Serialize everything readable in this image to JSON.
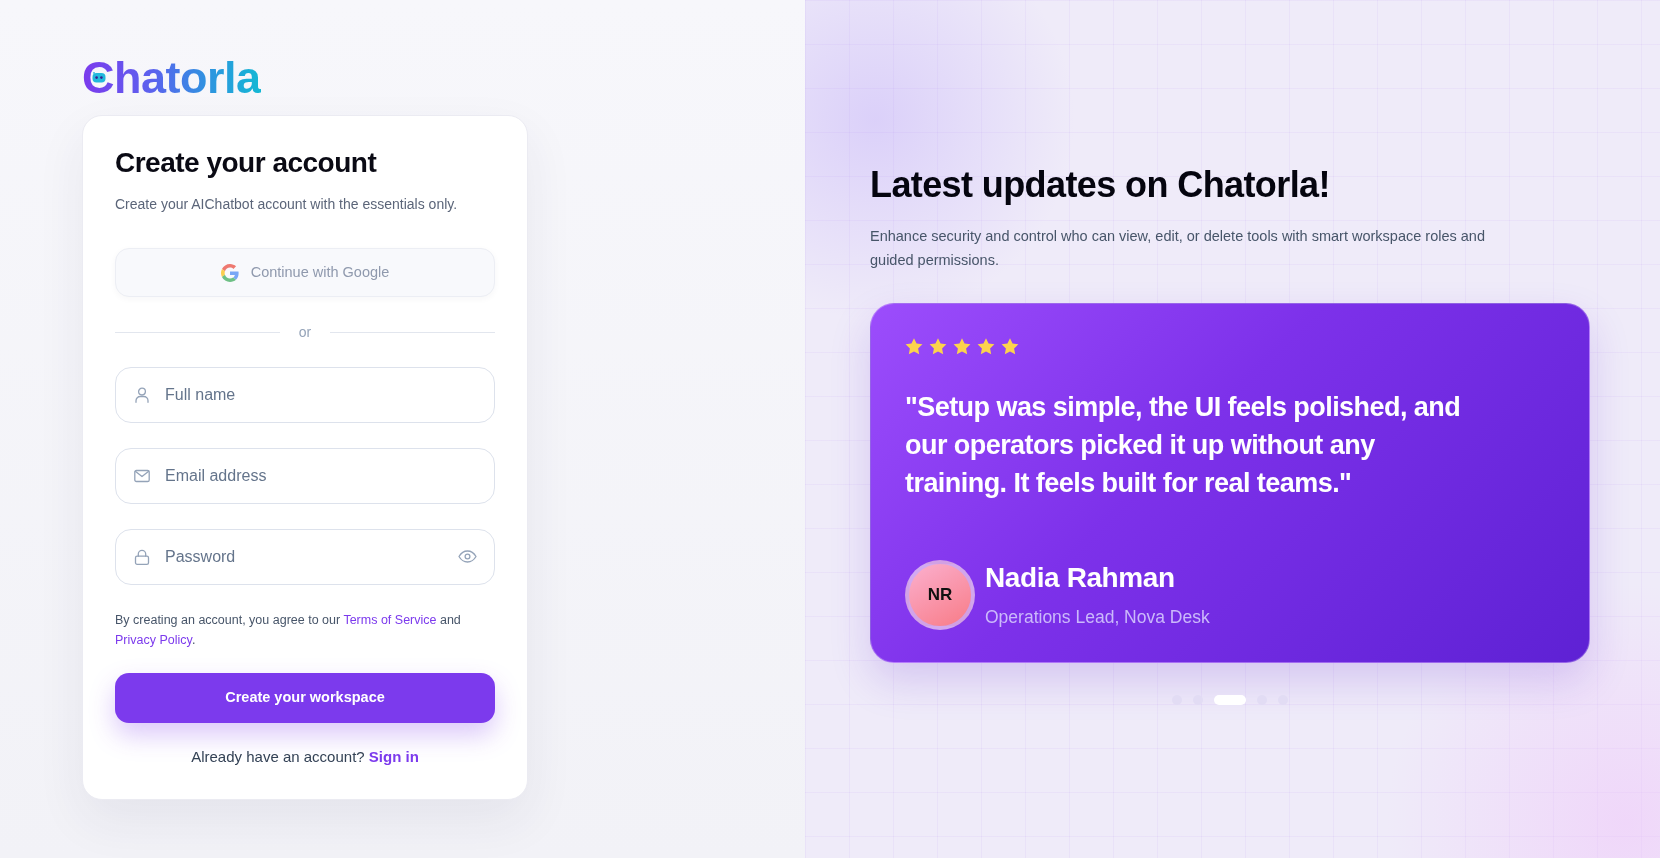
{
  "logo": {
    "text": "Chatorla"
  },
  "signup_card": {
    "title": "Create your account",
    "subtitle": "Create your AIChatbot account with the essentials only.",
    "google_button": {
      "label": "Continue with Google",
      "disabled": true
    },
    "divider": "or",
    "fields": [
      {
        "kind": "text",
        "placeholder": "Full name"
      },
      {
        "kind": "email",
        "placeholder": "Email address"
      },
      {
        "kind": "password",
        "placeholder": "Password"
      }
    ],
    "terms": [
      {
        "kind": "text",
        "text": "By creating an account, you agree to our "
      },
      {
        "kind": "link",
        "text": "Terms of Service"
      },
      {
        "kind": "text",
        "text": " and "
      },
      {
        "kind": "link",
        "text": "Privacy Policy"
      },
      {
        "kind": "text",
        "text": "."
      }
    ],
    "submit_button": "Create your workspace",
    "signin_prompt": {
      "text": "Already have an account?",
      "link": "Sign in"
    }
  },
  "updates": {
    "title": "Latest updates on Chatorla!",
    "description": "Enhance security and control who can view, edit, or delete tools with smart workspace roles and guided permissions.",
    "testimonial": {
      "stars": 5,
      "quote": "\"Setup was simple, the UI feels polished, and our operators picked it up without any training. It feels built for real teams.\"",
      "avatar_initials": "NR",
      "name": "Nadia Rahman",
      "role": "Operations Lead, Nova Desk"
    },
    "carousel_dots": [
      {
        "selected": false
      },
      {
        "selected": false
      },
      {
        "selected": true
      },
      {
        "selected": false
      },
      {
        "selected": false
      }
    ]
  }
}
